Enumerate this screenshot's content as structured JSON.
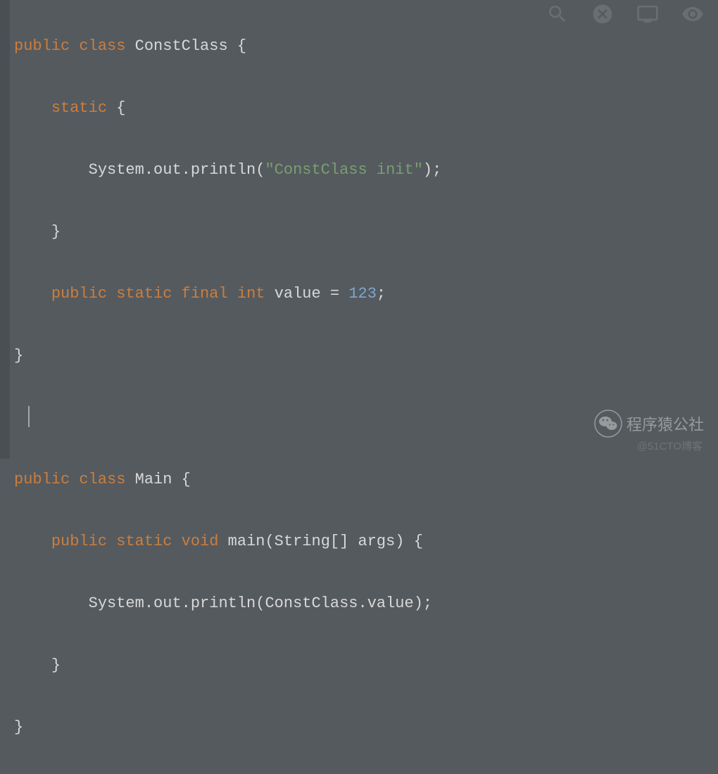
{
  "code": {
    "lines": [
      "public class ConstClass {",
      "    static {",
      "        System.out.println(\"ConstClass init\");",
      "    }",
      "    public static final int value = 123;",
      "}",
      "",
      "public class Main {",
      "    public static void main(String[] args) {",
      "        System.out.println(ConstClass.value);",
      "    }",
      "}"
    ],
    "tokens": {
      "l0_kw1": "public",
      "l0_kw2": "class",
      "l0_cls": "ConstClass",
      "l0_brace": " {",
      "l1_pad": "    ",
      "l1_kw": "static",
      "l1_brace": " {",
      "l2_pad": "        ",
      "l2_sys": "System.out.println(",
      "l2_str": "\"ConstClass init\"",
      "l2_end": ");",
      "l3_pad": "    ",
      "l3_brace": "}",
      "l4_pad": "    ",
      "l4_kw1": "public",
      "l4_kw2": "static",
      "l4_kw3": "final",
      "l4_kw4": "int",
      "l4_var": "value = ",
      "l4_num": "123",
      "l4_end": ";",
      "l5_brace": "}",
      "l7_kw1": "public",
      "l7_kw2": "class",
      "l7_cls": "Main",
      "l7_brace": " {",
      "l8_pad": "    ",
      "l8_kw1": "public",
      "l8_kw2": "static",
      "l8_kw3": "void",
      "l8_fn": "main(String[] args)",
      "l8_brace": " {",
      "l9_pad": "        ",
      "l9_sys": "System.out.println(ConstClass.value);",
      "l10_pad": "    ",
      "l10_brace": "}",
      "l11_brace": "}"
    }
  },
  "watermark": {
    "wechat": "程序猿公社",
    "blog": "@51CTO博客"
  },
  "toolbar": {
    "icon1": "search-icon",
    "icon2": "close-circle-icon",
    "icon3": "monitor-icon",
    "icon4": "eye-icon"
  }
}
